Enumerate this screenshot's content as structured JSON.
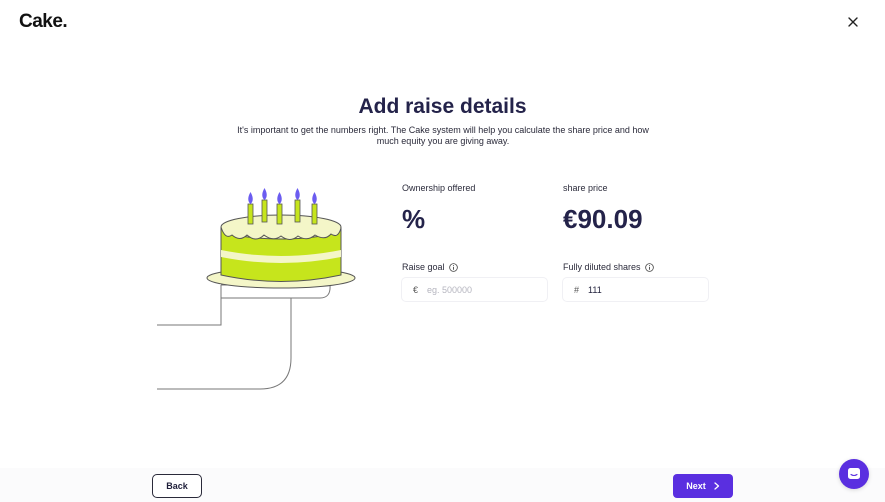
{
  "brand": {
    "logo_text": "Cake."
  },
  "header": {
    "title": "Add raise details",
    "subtitle": "It's important to get the numbers right. The Cake system will help you calculate the share price and how much equity you are giving away."
  },
  "ownership": {
    "label": "Ownership offered",
    "value": "%"
  },
  "share_price": {
    "label": "share price",
    "value": "€90.09"
  },
  "raise_goal": {
    "label": "Raise goal",
    "prefix": "€",
    "value": "",
    "placeholder": "eg. 500000"
  },
  "diluted_shares": {
    "label": "Fully diluted shares",
    "prefix": "#",
    "value": "111"
  },
  "footer": {
    "back_label": "Back",
    "next_label": "Next"
  },
  "icons": {
    "close": "close-icon",
    "info": "info-icon",
    "chevron": "chevron-right-icon",
    "chat": "chat-icon"
  },
  "colors": {
    "primary": "#5a2fe0",
    "heading": "#24234a",
    "cake_green": "#c6e51c",
    "cake_cream": "#f4f6c8",
    "candle_flame": "#6b5cf0"
  }
}
